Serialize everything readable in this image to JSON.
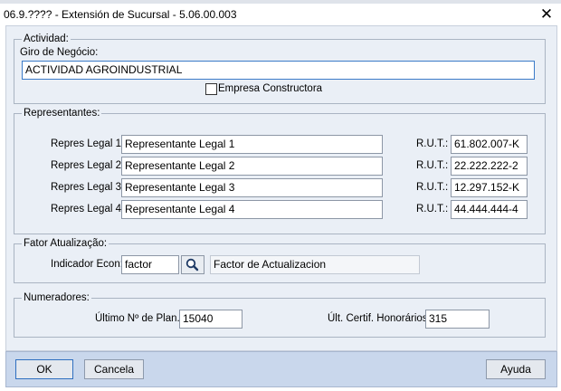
{
  "window": {
    "title": "06.9.???? - Extensión de Sucursal - 5.06.00.003",
    "close_glyph": "✕"
  },
  "actividad": {
    "legend": "Actividad:",
    "giro_label": "Giro de Negócio:",
    "giro_value": "ACTIVIDAD AGROINDUSTRIAL",
    "constructora_label": "Empresa Constructora",
    "constructora_checked": false
  },
  "representantes": {
    "legend": "Representantes:",
    "rut_label": "R.U.T.:",
    "rows": [
      {
        "label": "Repres Legal 1:",
        "name": "Representante Legal 1",
        "rut": "61.802.007-K"
      },
      {
        "label": "Repres Legal 2:",
        "name": "Representante Legal 2",
        "rut": "22.222.222-2"
      },
      {
        "label": "Repres Legal 3:",
        "name": "Representante Legal 3",
        "rut": "12.297.152-K"
      },
      {
        "label": "Repres Legal 4:",
        "name": "Representante Legal 4",
        "rut": "44.444.444-4"
      }
    ]
  },
  "fator": {
    "legend": "Fator Atualização:",
    "indicador_label": "Indicador Econ:",
    "indicador_value": "factor",
    "descripcion": "Factor de Actualizacion",
    "lookup_icon": "magnifier-icon"
  },
  "numeradores": {
    "legend": "Numeradores:",
    "ultimo_plan_label": "Último Nº de Plan.:",
    "ultimo_plan_value": "15040",
    "ult_certif_label": "Últ. Certif. Honorários",
    "ult_certif_value": "315"
  },
  "buttons": {
    "ok": "OK",
    "cancela": "Cancela",
    "ayuda": "Ayuda"
  },
  "colors": {
    "dialog_bg": "#eaeff6",
    "footer_bg": "#c9d7ec",
    "focus_border": "#3b7bc8"
  }
}
